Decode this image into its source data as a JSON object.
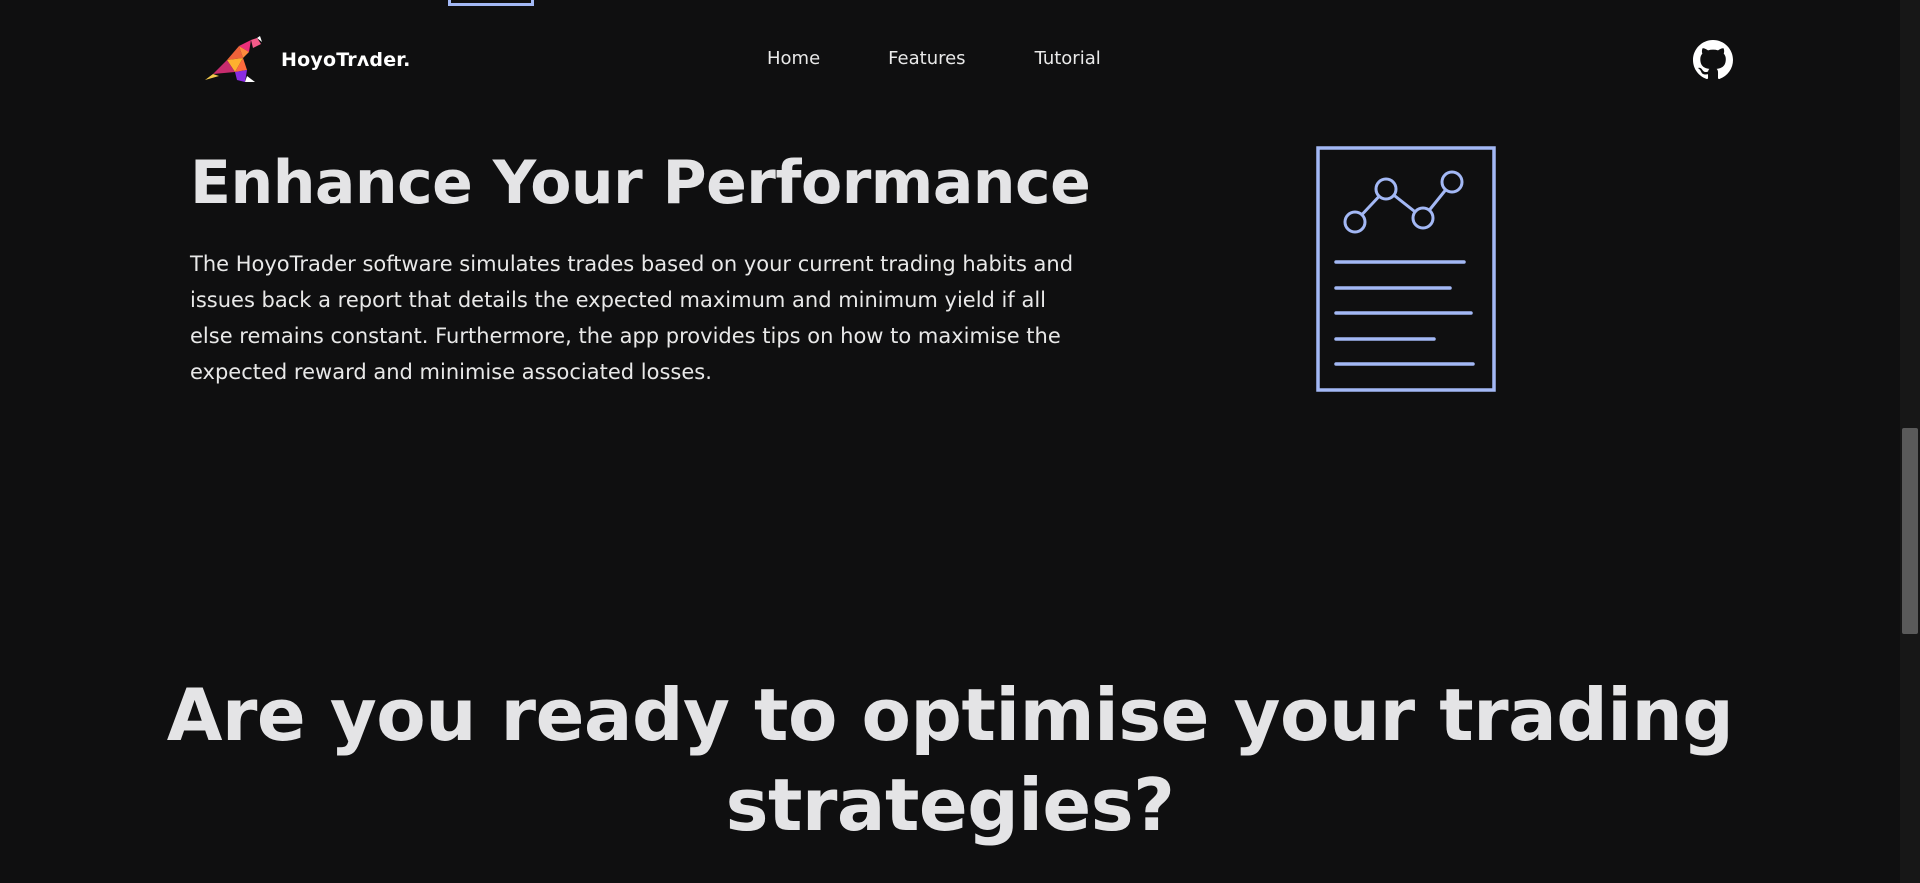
{
  "header": {
    "brand_name": "HoyoTrʌder.",
    "nav": [
      {
        "label": "Home"
      },
      {
        "label": "Features"
      },
      {
        "label": "Tutorial"
      }
    ],
    "github_icon": "github-icon"
  },
  "performance": {
    "title": "Enhance Your Performance",
    "body": "The HoyoTrader software simulates trades based on your current trading habits and issues back a report that details the expected maximum and minimum yield if all else remains constant. Furthermore, the app provides tips on how to maximise the expected reward and minimise associated losses.",
    "illustration_icon": "report-chart-icon"
  },
  "cta": {
    "heading": "Are you ready to optimise your trading strategies?"
  },
  "colors": {
    "background": "#0f0f10",
    "accent": "#a3b8f5",
    "text": "#e4e4e6"
  }
}
